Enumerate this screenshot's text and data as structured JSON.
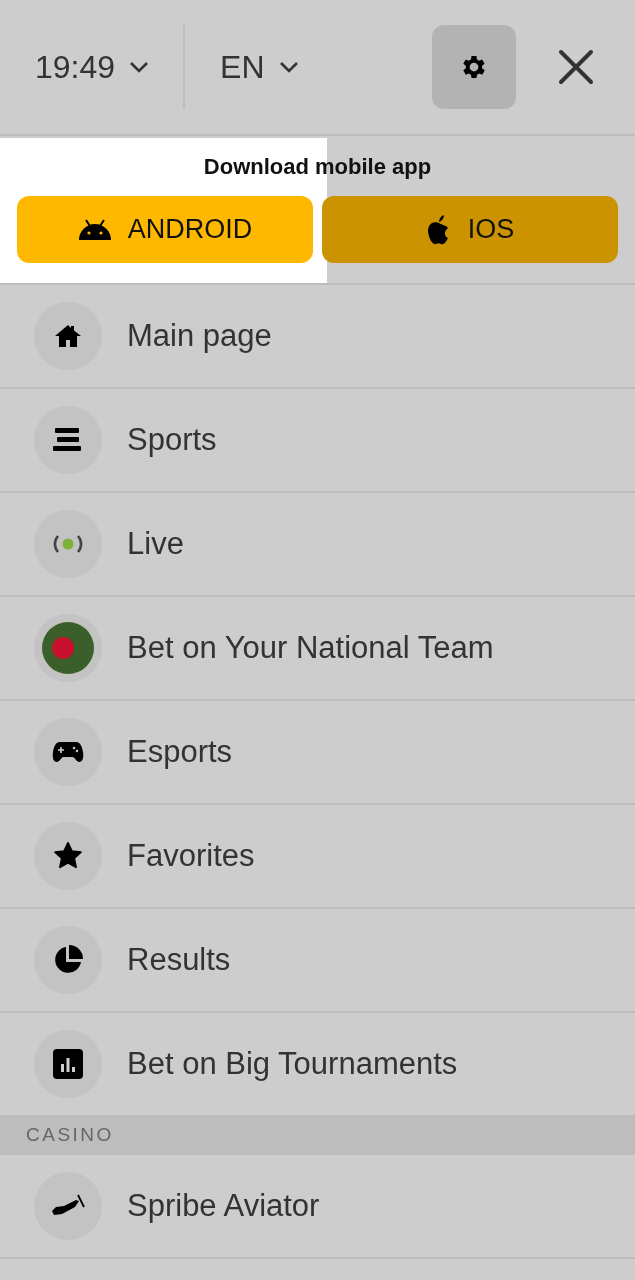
{
  "header": {
    "time": "19:49",
    "language": "EN"
  },
  "download": {
    "title": "Download mobile app",
    "buttons": [
      {
        "label": "ANDROID",
        "kind": "android",
        "highlighted": true
      },
      {
        "label": "IOS",
        "kind": "ios",
        "highlighted": false
      }
    ]
  },
  "menu": [
    {
      "label": "Main page",
      "kind": "home"
    },
    {
      "label": "Sports",
      "kind": "sports"
    },
    {
      "label": "Live",
      "kind": "live"
    },
    {
      "label": "Bet on Your National Team",
      "kind": "flag"
    },
    {
      "label": "Esports",
      "kind": "gamepad"
    },
    {
      "label": "Favorites",
      "kind": "star"
    },
    {
      "label": "Results",
      "kind": "pie"
    },
    {
      "label": "Bet on Big Tournaments",
      "kind": "chart"
    }
  ],
  "casino": {
    "title": "CASINO",
    "items": [
      {
        "label": "Spribe Aviator",
        "kind": "plane"
      }
    ]
  }
}
